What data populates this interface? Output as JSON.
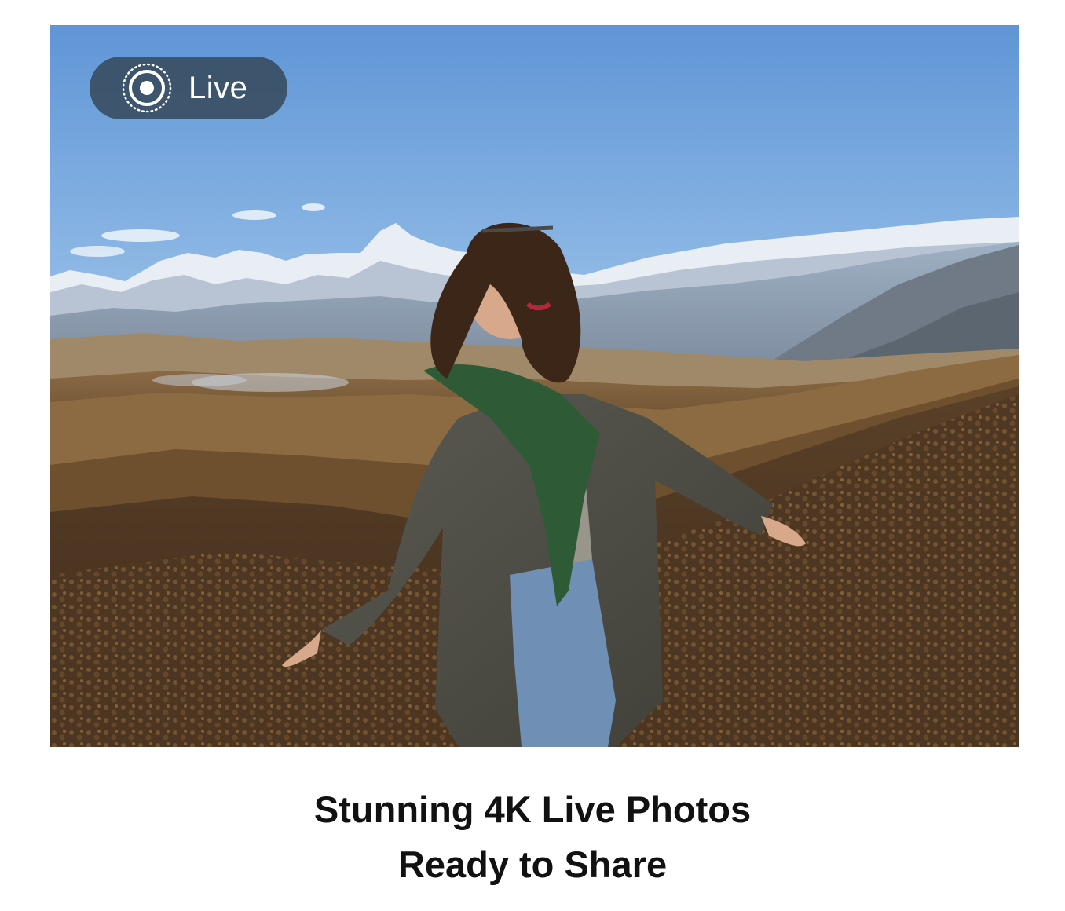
{
  "photo": {
    "live_badge": {
      "label": "Live",
      "icon": "live-photo-icon"
    }
  },
  "caption": {
    "line1": "Stunning 4K Live Photos",
    "line2": "Ready to Share"
  },
  "colors": {
    "badge_bg": "#3a4e64",
    "caption_text": "#111111",
    "background": "#ffffff"
  }
}
